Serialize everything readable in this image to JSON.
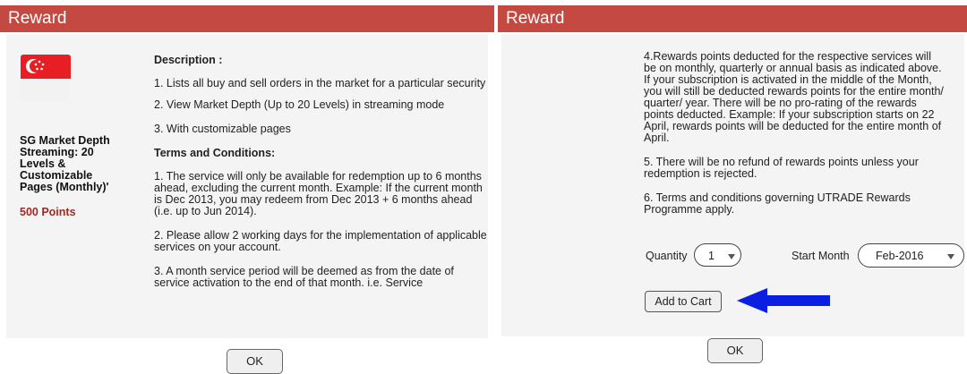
{
  "left": {
    "title": "Reward",
    "product_name": "SG Market Depth Streaming: 20 Levels & Customizable Pages (Monthly)'",
    "points": "500 Points",
    "description_heading": "Description :",
    "description_items": [
      "1. Lists all buy and sell orders in the market for a particular security",
      "2. View Market Depth (Up to 20 Levels) in streaming mode",
      "3. With customizable pages"
    ],
    "terms_heading": "Terms and Conditions:",
    "terms_items": [
      "1. The service will only be available for redemption up to 6 months ahead, excluding the current month. Example: If the current month is Dec 2013, you may redeem from Dec 2013 + 6 months ahead (i.e. up to Jun 2014).",
      "2. Please allow 2 working days for the implementation of applicable services on your account.",
      "3. A month service period will be deemed as from the date of service activation to the end of that month. i.e. Service"
    ],
    "ok_label": "OK"
  },
  "right": {
    "title": "Reward",
    "terms_items": [
      "4.Rewards points deducted for the respective services will be on monthly, quarterly or annual basis as indicated above. If your subscription is activated in the middle of the Month, you will still be deducted rewards points for the entire month/ quarter/ year. There will be no pro-rating of the rewards points deducted. Example: If your subscription starts on 22 April, rewards points will be deducted for the entire month of April.",
      "5. There will be no refund of rewards points unless your redemption is rejected.",
      "6. Terms and conditions governing UTRADE Rewards Programme apply."
    ],
    "quantity_label": "Quantity",
    "quantity_value": "1",
    "start_month_label": "Start Month",
    "start_month_value": "Feb-2016",
    "add_to_cart_label": "Add to Cart",
    "ok_label": "OK"
  },
  "icons": {
    "flag": "singapore-flag-icon",
    "arrow": "blue-left-arrow-icon"
  },
  "colors": {
    "header": "#c44941",
    "points": "#a4281f",
    "arrow": "#0a1fe0",
    "flag_red": "#e81e25"
  }
}
